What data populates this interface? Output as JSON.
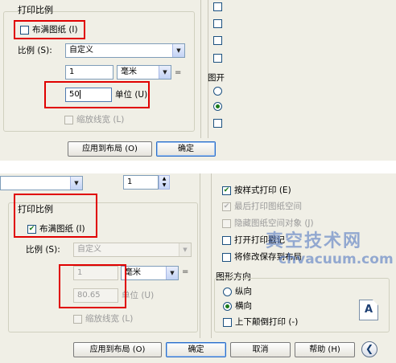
{
  "top": {
    "section_title": "打印比例",
    "fit_paper": "布满图纸 (I)",
    "scale_label": "比例 (S):",
    "scale_value": "自定义",
    "value1": "1",
    "unit": "毫米",
    "value2": "50",
    "unit_label": "单位 (U)",
    "scale_lineweights": "缩放线宽 (L)",
    "apply_layout": "应用到布局 (O)",
    "ok": "确定",
    "right_label": "图开"
  },
  "bottom": {
    "copies": "1",
    "section_title": "打印比例",
    "fit_paper": "布满图纸 (I)",
    "fit_checked": "✔",
    "scale_label": "比例 (S):",
    "scale_value": "自定义",
    "value1": "1",
    "unit": "毫米",
    "value2": "80.65",
    "unit_label": "单位 (U)",
    "scale_lineweights": "缩放线宽 (L)",
    "options": [
      {
        "label": "按样式打印 (E)",
        "checked": true,
        "disabled": false
      },
      {
        "label": "最后打印图纸空间",
        "checked": true,
        "disabled": true
      },
      {
        "label": "隐藏图纸空间对象 (J)",
        "checked": false,
        "disabled": true
      },
      {
        "label": "打开打印戳记",
        "checked": false,
        "disabled": false
      },
      {
        "label": "将修改保存到布局",
        "checked": false,
        "disabled": false
      }
    ],
    "orientation_title": "图形方向",
    "portrait": "纵向",
    "landscape": "横向",
    "upside_down": "上下颠倒打印 (-)",
    "orientation_icon": "A",
    "apply_layout": "应用到布局 (O)",
    "ok": "确定",
    "cancel": "取消",
    "help": "帮助 (H)"
  },
  "watermark": {
    "title": "真空技术网",
    "url": "chvacuum.com"
  },
  "icons": {
    "expand": "chevron-left-icon",
    "orientation": "paper-a-icon",
    "spinner": "spinner-arrows-icon"
  },
  "colors": {
    "highlight": "#e00000",
    "dialog_bg": "#f0efe6",
    "check": "#1a7a1a"
  }
}
